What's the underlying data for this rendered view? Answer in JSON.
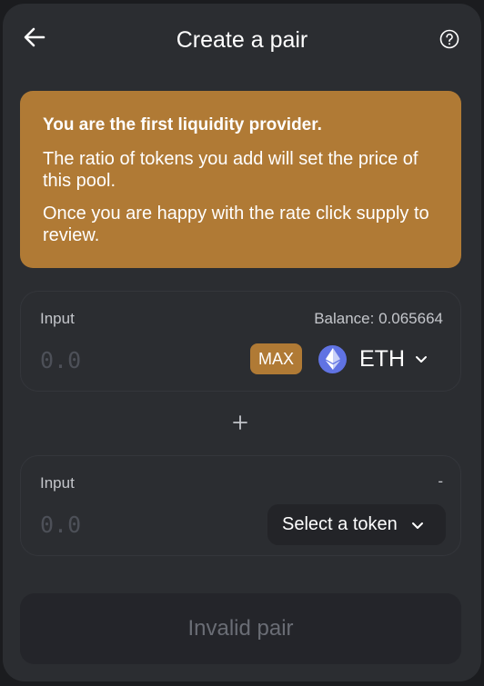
{
  "header": {
    "title": "Create a pair"
  },
  "banner": {
    "heading": "You are the first liquidity provider.",
    "text1": "The ratio of tokens you add will set the price of this pool.",
    "text2": "Once you are happy with the rate click supply to review."
  },
  "input_a": {
    "label": "Input",
    "balance": "Balance: 0.065664",
    "placeholder": "0.0",
    "max_label": "MAX",
    "token_symbol": "ETH",
    "token_icon": "ethereum-icon"
  },
  "plus_icon": "plus-icon",
  "input_b": {
    "label": "Input",
    "balance": "-",
    "placeholder": "0.0",
    "select_label": "Select a token"
  },
  "submit": {
    "label": "Invalid pair"
  },
  "colors": {
    "background": "#2b2d31",
    "accent": "#b07a35",
    "eth": "#6073e3",
    "disabled_text": "#6a6d75"
  }
}
